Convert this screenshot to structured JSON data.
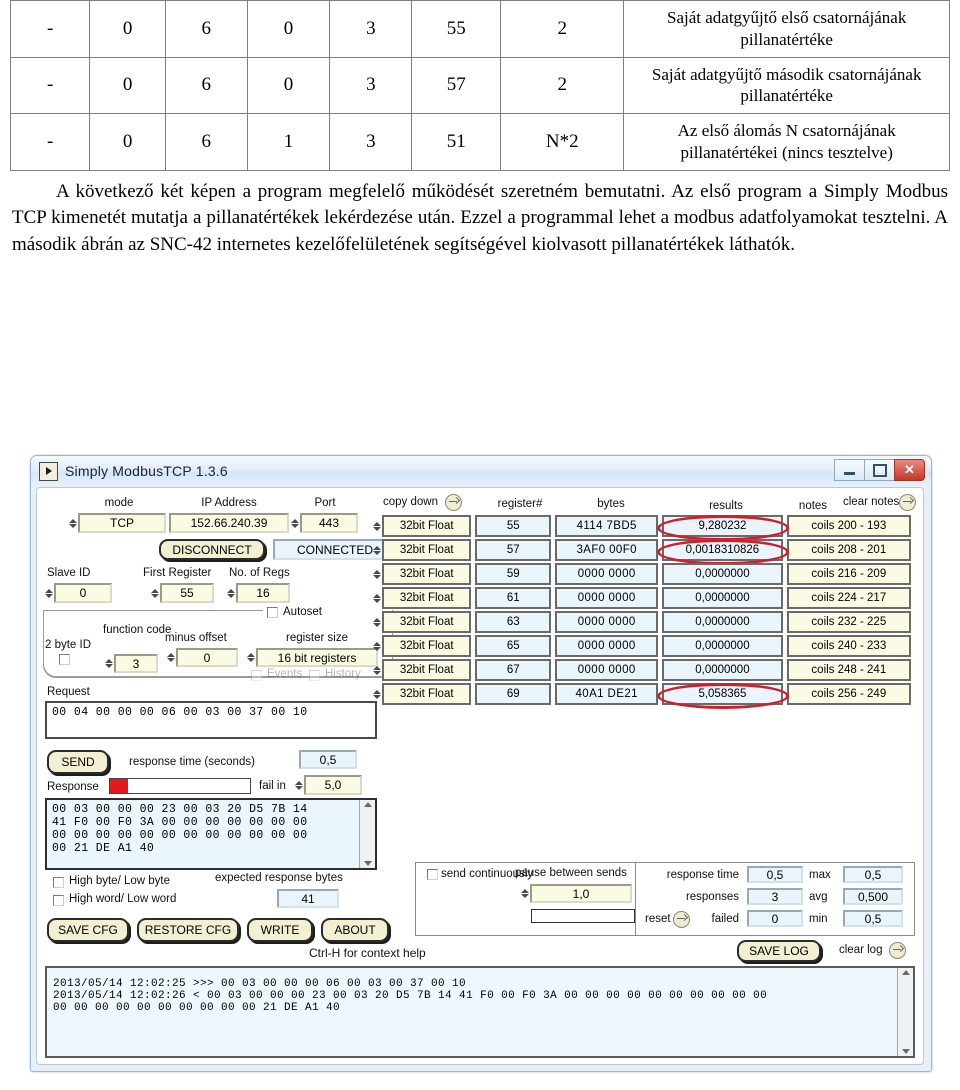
{
  "document": {
    "table": {
      "rows": [
        {
          "cells": [
            "-",
            "0",
            "6",
            "0",
            "3",
            "55",
            "2"
          ],
          "description": "Saját adatgyűjtő első csatornájának pillanatértéke"
        },
        {
          "cells": [
            "-",
            "0",
            "6",
            "0",
            "3",
            "57",
            "2"
          ],
          "description": "Saját adatgyűjtő második csatornájának pillanatértéke"
        },
        {
          "cells": [
            "-",
            "0",
            "6",
            "1",
            "3",
            "51",
            "N*2"
          ],
          "description": "Az első álomás N csatornájának pillanatértékei (nincs tesztelve)"
        }
      ]
    },
    "paragraph": "A következő két képen a program megfelelő működését szeretném bemutatni. Az első program a Simply Modbus TCP kimenetét mutatja a pillanatértékek lekérdezése után. Ezzel a programmal lehet a modbus adatfolyamokat tesztelni. A második ábrán az SNC-42 internetes kezelőfelületének segítségével kiolvasott pillanatértékek láthatók."
  },
  "app": {
    "title": "Simply ModbusTCP 1.3.6",
    "window_buttons": {
      "minimize": "–",
      "maximize": "□",
      "close": "✕"
    },
    "connection": {
      "mode_label": "mode",
      "mode_value": "TCP",
      "ip_label": "IP Address",
      "ip_value": "152.66.240.39",
      "port_label": "Port",
      "port_value": "443",
      "disconnect_label": "DISCONNECT",
      "status_value": "CONNECTED"
    },
    "registers": {
      "slave_id_label": "Slave ID",
      "slave_id_value": "0",
      "first_register_label": "First Register",
      "first_register_value": "55",
      "no_of_regs_label": "No. of Regs",
      "no_of_regs_value": "16"
    },
    "options": {
      "two_byte_id_label": "2 byte ID",
      "function_code_label": "function code",
      "function_code_value": "3",
      "minus_offset_label": "minus offset",
      "minus_offset_value": "0",
      "autoset_label": "Autoset",
      "register_size_label": "register size",
      "register_size_value": "16 bit registers",
      "events_label": "Events",
      "history_label": "History"
    },
    "copy_down_label": "copy down",
    "clear_notes_label": "clear notes",
    "table": {
      "headers": [
        "register#",
        "bytes",
        "results",
        "notes"
      ],
      "rows": [
        {
          "type": "32bit Float",
          "register": "55",
          "bytes": "4114  7BD5",
          "result": "9,280232",
          "note": "coils 200 - 193",
          "highlighted": true
        },
        {
          "type": "32bit Float",
          "register": "57",
          "bytes": "3AF0  00F0",
          "result": "0,0018310826",
          "note": "coils 208 - 201",
          "highlighted": true
        },
        {
          "type": "32bit Float",
          "register": "59",
          "bytes": "0000  0000",
          "result": "0,0000000",
          "note": "coils 216 - 209",
          "highlighted": false
        },
        {
          "type": "32bit Float",
          "register": "61",
          "bytes": "0000  0000",
          "result": "0,0000000",
          "note": "coils 224 - 217",
          "highlighted": false
        },
        {
          "type": "32bit Float",
          "register": "63",
          "bytes": "0000  0000",
          "result": "0,0000000",
          "note": "coils 232 - 225",
          "highlighted": false
        },
        {
          "type": "32bit Float",
          "register": "65",
          "bytes": "0000  0000",
          "result": "0,0000000",
          "note": "coils 240 - 233",
          "highlighted": false
        },
        {
          "type": "32bit Float",
          "register": "67",
          "bytes": "0000  0000",
          "result": "0,0000000",
          "note": "coils 248 - 241",
          "highlighted": false
        },
        {
          "type": "32bit Float",
          "register": "69",
          "bytes": "40A1  DE21",
          "result": "5,058365",
          "note": "coils 256 - 249",
          "highlighted": true
        }
      ]
    },
    "request": {
      "label": "Request",
      "value": "00 04 00 00 00 06 00 03 00 37 00 10",
      "send_label": "SEND",
      "response_time_label": "response time (seconds)",
      "response_time_value": "0,5",
      "fail_in_label": "fail in",
      "fail_in_value": "5,0"
    },
    "response": {
      "label": "Response",
      "lines": [
        "00 03 00 00 00 23 00 03 20 D5 7B 14",
        "41 F0 00 F0 3A 00 00 00 00 00 00 00",
        "00 00 00 00 00 00 00 00 00 00 00 00",
        "00 21 DE A1 40"
      ]
    },
    "byteorder": {
      "high_byte_label": "High byte/ Low byte",
      "high_word_label": "High word/ Low word",
      "expected_bytes_label": "expected response bytes",
      "expected_bytes_value": "41"
    },
    "buttons": {
      "save_cfg": "SAVE CFG",
      "restore_cfg": "RESTORE CFG",
      "write": "WRITE",
      "about": "ABOUT"
    },
    "continuous": {
      "send_continuously_label": "send continuously",
      "pause_label": "pause between sends",
      "pause_value": "1,0"
    },
    "stats": {
      "response_time_label": "response time",
      "response_time_value": "0,5",
      "max_label": "max",
      "max_value": "0,5",
      "responses_label": "responses",
      "responses_value": "3",
      "avg_label": "avg",
      "avg_value": "0,500",
      "reset_label": "reset",
      "failed_label": "failed",
      "failed_value": "0",
      "min_label": "min",
      "min_value": "0,5"
    },
    "footer": {
      "help_text": "Ctrl-H for context help",
      "save_log_label": "SAVE LOG",
      "clear_log_label": "clear log"
    },
    "log": {
      "lines": [
        "2013/05/14 12:02:25  >>> 00 03 00 00 00 06 00 03 00 37 00 10",
        "2013/05/14 12:02:26  < 00 03 00 00 00 23 00 03 20 D5 7B 14 41 F0 00 F0 3A 00 00 00 00 00 00 00 00 00 00",
        "00 00 00 00 00 00 00 00 00 00 21 DE A1 40"
      ]
    }
  },
  "colors": {
    "field_yellow": "#fbfbe4",
    "field_blue": "#e9f4fb",
    "highlight_red": "#cf1f2d",
    "title_blue": "#d5e6f7"
  }
}
